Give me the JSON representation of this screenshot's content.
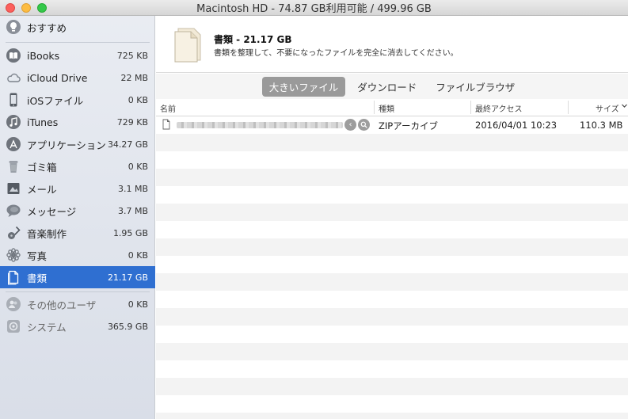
{
  "window": {
    "title": "Macintosh HD - 74.87 GB利用可能 / 499.96 GB"
  },
  "sidebar": {
    "top_item": {
      "label": "おすすめ",
      "icon": "lightbulb-icon"
    },
    "items": [
      {
        "label": "iBooks",
        "size": "725 KB",
        "icon": "book-icon"
      },
      {
        "label": "iCloud Drive",
        "size": "22 MB",
        "icon": "cloud-icon"
      },
      {
        "label": "iOSファイル",
        "size": "0 KB",
        "icon": "phone-icon"
      },
      {
        "label": "iTunes",
        "size": "729 KB",
        "icon": "music-note-icon"
      },
      {
        "label": "アプリケーション",
        "size": "34.27 GB",
        "icon": "app-store-icon"
      },
      {
        "label": "ゴミ箱",
        "size": "0 KB",
        "icon": "trash-icon"
      },
      {
        "label": "メール",
        "size": "3.1 MB",
        "icon": "mail-icon"
      },
      {
        "label": "メッセージ",
        "size": "3.7 MB",
        "icon": "message-bubble-icon"
      },
      {
        "label": "音楽制作",
        "size": "1.95 GB",
        "icon": "guitar-icon"
      },
      {
        "label": "写真",
        "size": "0 KB",
        "icon": "photos-flower-icon"
      },
      {
        "label": "書類",
        "size": "21.17 GB",
        "icon": "document-icon",
        "selected": true
      }
    ],
    "bottom_items": [
      {
        "label": "その他のユーザ",
        "size": "0 KB",
        "icon": "users-icon"
      },
      {
        "label": "システム",
        "size": "365.9 GB",
        "icon": "system-gear-icon"
      }
    ]
  },
  "header": {
    "title": "書類 - 21.17 GB",
    "description": "書類を整理して、不要になったファイルを完全に消去してください。"
  },
  "tabs": [
    {
      "label": "大きいファイル",
      "active": true
    },
    {
      "label": "ダウンロード",
      "active": false
    },
    {
      "label": "ファイルブラウザ",
      "active": false
    }
  ],
  "table": {
    "columns": {
      "name": "名前",
      "kind": "種類",
      "last_access": "最終アクセス",
      "size": "サイズ"
    },
    "rows": [
      {
        "kind": "ZIPアーカイブ",
        "last_access": "2016/04/01 10:23",
        "size": "110.3 MB"
      }
    ]
  },
  "colors": {
    "selection": "#2f6fd1",
    "active_tab": "#9a9a9a"
  }
}
